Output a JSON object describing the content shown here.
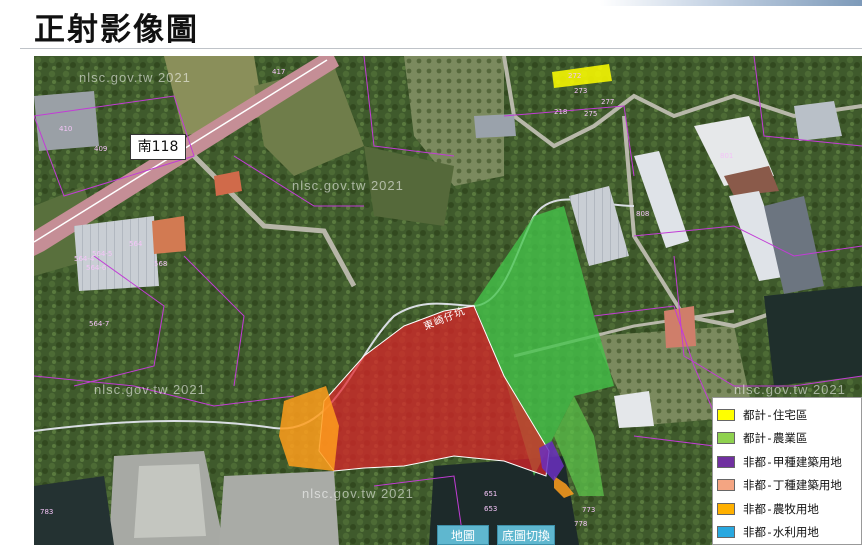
{
  "page": {
    "title": "正射影像圖"
  },
  "map": {
    "road_tag": "南118",
    "road_name": "東崎仔坑",
    "watermarks": [
      "nlsc.gov.tw 2021",
      "nlsc.gov.tw 2021",
      "nlsc.gov.tw 2021",
      "nlsc.gov.tw 2021",
      "nlsc.gov.tw 2021"
    ],
    "parcel_labels": [
      "410",
      "409",
      "564",
      "564-5",
      "564-6",
      "564-4",
      "564-7",
      "568",
      "417",
      "272",
      "273",
      "277",
      "275",
      "218",
      "801",
      "808",
      "651",
      "653",
      "773",
      "778",
      "783",
      "575"
    ]
  },
  "legend": {
    "items": [
      {
        "label": "都計-住宅區",
        "color": "#ffff00"
      },
      {
        "label": "都計-農業區",
        "color": "#8fd14f"
      },
      {
        "label": "非都-甲種建築用地",
        "color": "#7030a0"
      },
      {
        "label": "非都-丁種建築用地",
        "color": "#f4a582"
      },
      {
        "label": "非都-農牧用地",
        "color": "#ffb000"
      },
      {
        "label": "非都-水利用地",
        "color": "#29a8e0"
      }
    ]
  },
  "buttons": {
    "map_label": "地圖",
    "basemap_label": "底圖切換"
  }
}
